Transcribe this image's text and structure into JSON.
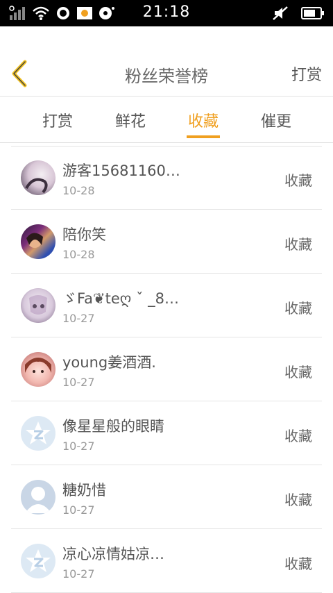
{
  "status_bar": {
    "time": "21:18",
    "icons": [
      "signal-icon",
      "wifi-icon",
      "notification-icon",
      "app-icon",
      "music-icon",
      "mute-icon",
      "battery-icon"
    ]
  },
  "header": {
    "title": "粉丝荣誉榜",
    "right_link": "打赏"
  },
  "tabs": [
    {
      "label": "打赏",
      "active": false
    },
    {
      "label": "鲜花",
      "active": false
    },
    {
      "label": "收藏",
      "active": true
    },
    {
      "label": "催更",
      "active": false
    }
  ],
  "colors": {
    "accent": "#f0a020",
    "text": "#555555",
    "muted": "#999999",
    "divider": "#e4e4e4"
  },
  "list": [
    {
      "name": "游客15681160…",
      "date": "10-28",
      "action": "收藏",
      "avatar": "photo-avatar"
    },
    {
      "name": "陪你笑",
      "date": "10-28",
      "action": "收藏",
      "avatar": "photo-avatar"
    },
    {
      "name": "ゞFa❦teღ ˇ _8…",
      "date": "10-27",
      "action": "收藏",
      "avatar": "photo-avatar"
    },
    {
      "name": "young姜酒酒.",
      "date": "10-27",
      "action": "收藏",
      "avatar": "photo-avatar"
    },
    {
      "name": "像星星般的眼睛",
      "date": "10-27",
      "action": "收藏",
      "avatar": "default-star-avatar"
    },
    {
      "name": "糖奶惜",
      "date": "10-27",
      "action": "收藏",
      "avatar": "default-person-avatar"
    },
    {
      "name": "凉心凉情姑凉…",
      "date": "10-27",
      "action": "收藏",
      "avatar": "default-star-avatar"
    }
  ]
}
